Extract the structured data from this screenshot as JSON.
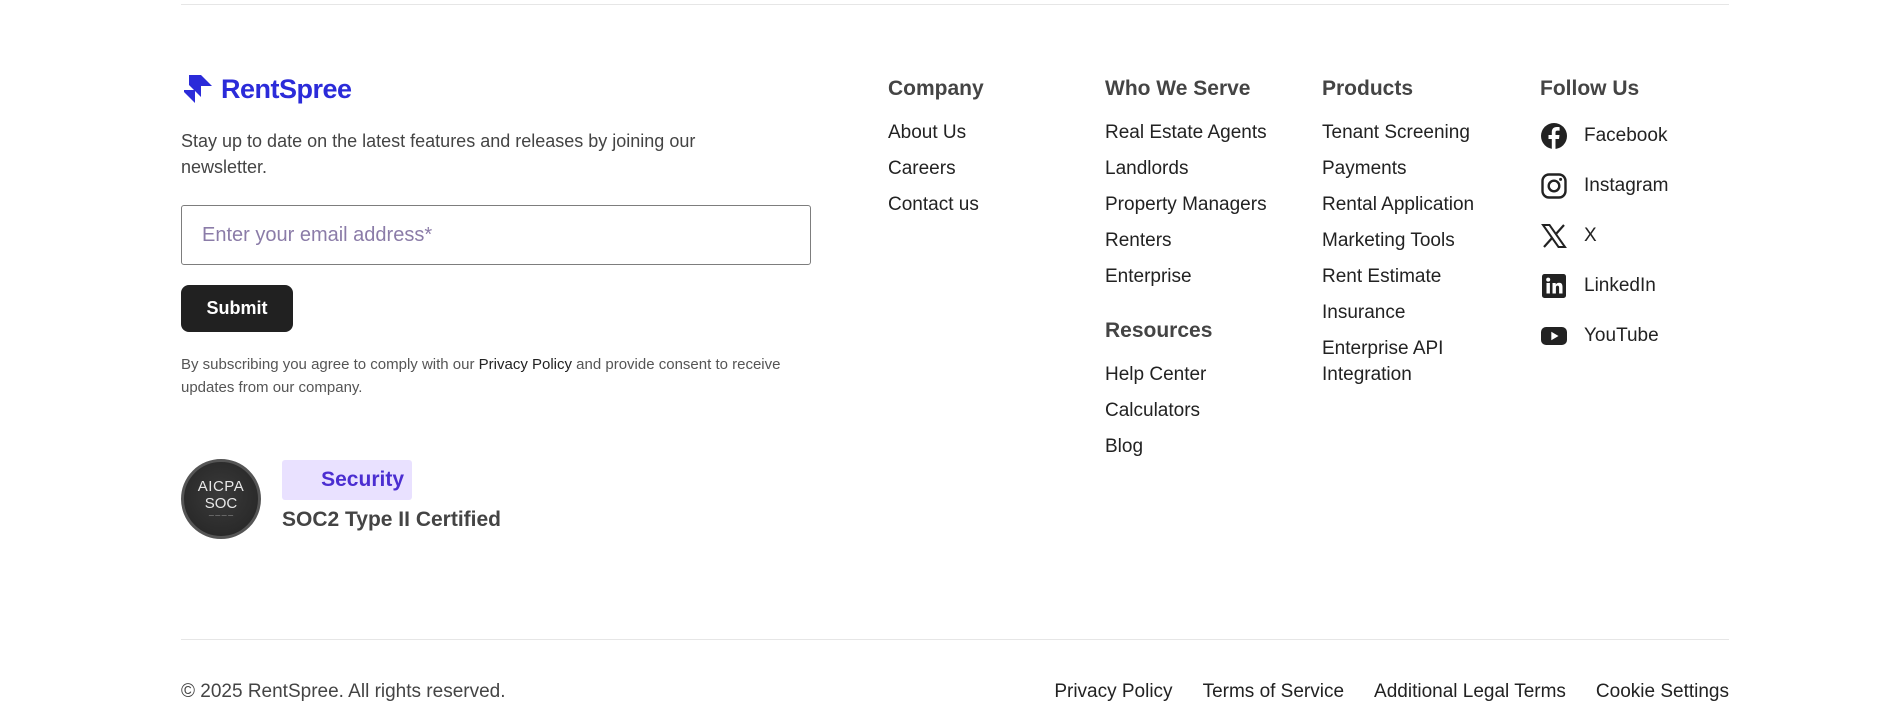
{
  "brand": {
    "name": "RentSpree",
    "color": "#2b2bd9"
  },
  "newsletter": {
    "text": "Stay up to date on the latest features and releases by joining our newsletter.",
    "email_placeholder": "Enter your email address*",
    "submit_label": "Submit",
    "consent_before": "By subscribing you agree to comply with our ",
    "consent_link": "Privacy Policy",
    "consent_after": " and provide consent to receive updates from our company."
  },
  "soc": {
    "badge_line1": "AICPA",
    "badge_line2": "SOC",
    "security_label": "Security",
    "certified_label": "SOC2 Type II Certified"
  },
  "columns": {
    "company": {
      "title": "Company",
      "links": [
        "About Us",
        "Careers",
        "Contact us"
      ]
    },
    "who_we_serve": {
      "title": "Who We Serve",
      "links": [
        "Real Estate Agents",
        "Landlords",
        "Property Managers",
        "Renters",
        "Enterprise"
      ]
    },
    "resources": {
      "title": "Resources",
      "links": [
        "Help Center",
        "Calculators",
        "Blog"
      ]
    },
    "products": {
      "title": "Products",
      "links": [
        "Tenant Screening",
        "Payments",
        "Rental Application",
        "Marketing Tools",
        "Rent Estimate",
        "Insurance",
        "Enterprise API Integration"
      ]
    },
    "follow_us": {
      "title": "Follow Us",
      "links": [
        {
          "label": "Facebook",
          "icon": "facebook-icon"
        },
        {
          "label": "Instagram",
          "icon": "instagram-icon"
        },
        {
          "label": "X",
          "icon": "x-icon"
        },
        {
          "label": "LinkedIn",
          "icon": "linkedin-icon"
        },
        {
          "label": "YouTube",
          "icon": "youtube-icon"
        }
      ]
    }
  },
  "footer": {
    "copyright": "© 2025 RentSpree. All rights reserved.",
    "legal_links": [
      "Privacy Policy",
      "Terms of Service",
      "Additional Legal Terms",
      "Cookie Settings"
    ]
  }
}
